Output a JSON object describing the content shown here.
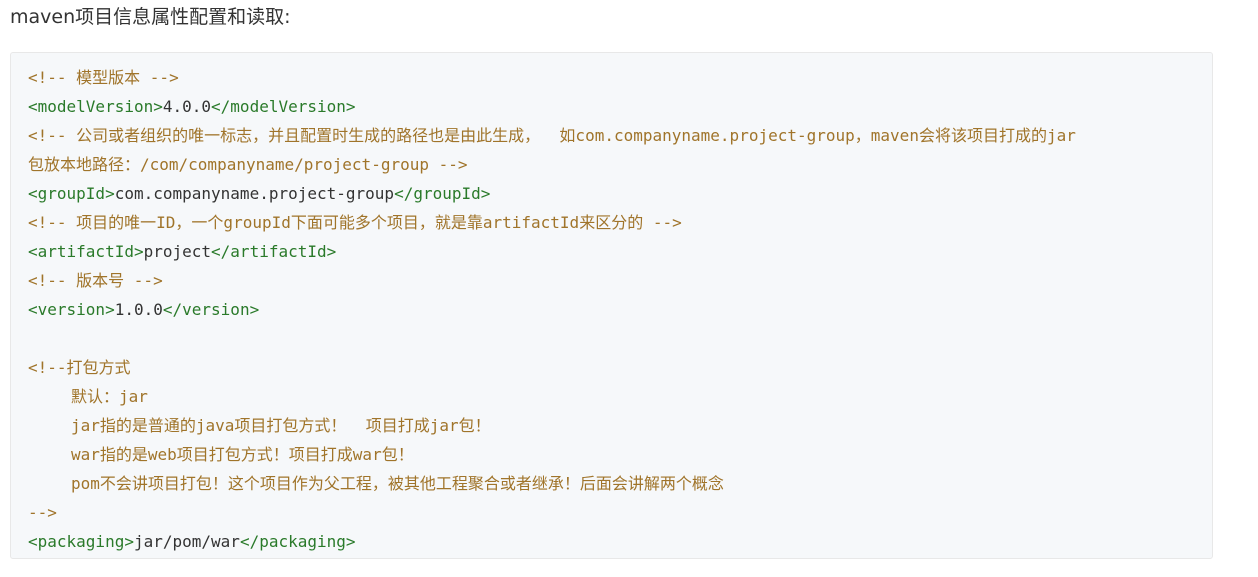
{
  "page": {
    "heading": "maven项目信息属性配置和读取:"
  },
  "code": {
    "l1": "<!-- 模型版本 -->",
    "l2": {
      "open": "<modelVersion>",
      "value": "4.0.0",
      "close": "</modelVersion>"
    },
    "l3": "<!-- 公司或者组织的唯一标志，并且配置时生成的路径也是由此生成，  如com.companyname.project-group，maven会将该项目打成的jar",
    "l4": "包放本地路径：/com/companyname/project-group -->",
    "l5": {
      "open": "<groupId>",
      "value": "com.companyname.project-group",
      "close": "</groupId>"
    },
    "l6": "<!-- 项目的唯一ID，一个groupId下面可能多个项目，就是靠artifactId来区分的 -->",
    "l7": {
      "open": "<artifactId>",
      "value": "project",
      "close": "</artifactId>"
    },
    "l8": "<!-- 版本号 -->",
    "l9": {
      "open": "<version>",
      "value": "1.0.0",
      "close": "</version>"
    },
    "l11": "<!--打包方式",
    "l12": "默认：jar",
    "l13": "jar指的是普通的java项目打包方式！  项目打成jar包！",
    "l14": "war指的是web项目打包方式！项目打成war包！",
    "l15": "pom不会讲项目打包！这个项目作为父工程，被其他工程聚合或者继承！后面会讲解两个概念",
    "l16": "-->",
    "l17": {
      "open": "<packaging>",
      "value": "jar/pom/war",
      "close": "</packaging>"
    }
  }
}
